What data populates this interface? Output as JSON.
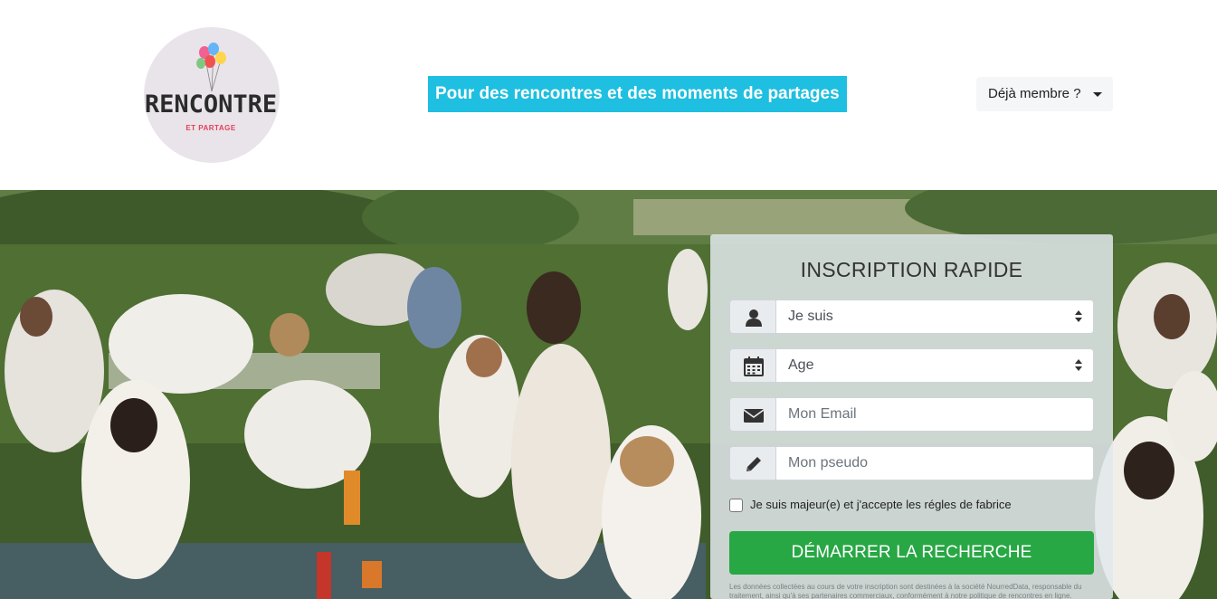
{
  "header": {
    "logo": {
      "word": "RENCONTRE",
      "sub": "ET PARTAGE",
      "balloon_colors": [
        "#f06292",
        "#64b5f6",
        "#ffd54f",
        "#ef5350",
        "#81c784"
      ]
    },
    "tagline": "Pour des rencontres et des moments de partages",
    "member_button": "Déjà membre ?"
  },
  "form": {
    "title": "INSCRIPTION RAPIDE",
    "gender_select": {
      "value": "Je suis",
      "icon": "user-icon"
    },
    "age_select": {
      "value": "Age",
      "icon": "calendar-icon"
    },
    "email_field": {
      "placeholder": "Mon Email",
      "icon": "envelope-icon"
    },
    "pseudo_field": {
      "placeholder": "Mon pseudo",
      "icon": "pencil-icon"
    },
    "consent_label": "Je suis majeur(e) et j'accepte les régles de fabrice",
    "submit_label": "DÉMARRER LA RECHERCHE",
    "legal_text": "Les données collectées au cours de votre inscription sont destinées à la société NourredData, responsable du traitement, ainsi qu'à ses partenaires commerciaux, conformément à notre politique de rencontres en ligne."
  },
  "colors": {
    "tagline_bg": "#1ebfe0",
    "cta_bg": "#28a745",
    "logo_accent": "#e2405a"
  }
}
